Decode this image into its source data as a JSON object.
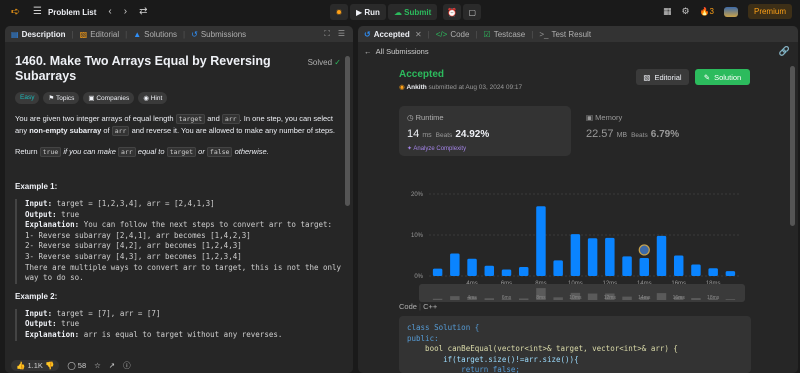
{
  "topbar": {
    "problem_list": "Problem List",
    "run": "Run",
    "submit": "Submit",
    "streak": "3",
    "premium": "Premium"
  },
  "left_tabs": [
    "Description",
    "Editorial",
    "Solutions",
    "Submissions"
  ],
  "problem": {
    "title": "1460. Make Two Arrays Equal by Reversing Subarrays",
    "solved": "Solved",
    "tags": [
      "Easy",
      "Topics",
      "Companies",
      "Hint"
    ],
    "para1_a": "You are given two integer arrays of equal length ",
    "code_target": "target",
    "para1_and": " and ",
    "code_arr": "arr",
    "para1_b": ". In one step, you can select any ",
    "para1_bold": "non-empty subarray",
    "para1_of": " of ",
    "para1_c": " and reverse it. You are allowed to make any number of steps.",
    "para2_a": "Return ",
    "code_true": "true",
    "para2_b": " if you can make ",
    "para2_c": " equal to ",
    "para2_d": " or ",
    "code_false": "false",
    "para2_e": " otherwise.",
    "example1_h": "Example 1:",
    "example1_input_label": "Input:",
    "example1_input": " target = [1,2,3,4], arr = [2,4,1,3]",
    "example1_output_label": "Output:",
    "example1_output": " true",
    "example1_expl_label": "Explanation:",
    "example1_expl": " You can follow the next steps to convert arr to target:\n1- Reverse subarray [2,4,1], arr becomes [1,4,2,3]\n2- Reverse subarray [4,2], arr becomes [1,2,4,3]\n3- Reverse subarray [4,3], arr becomes [1,2,3,4]\nThere are multiple ways to convert arr to target, this is not the only\nway to do so.",
    "example2_h": "Example 2:",
    "example2_input_label": "Input:",
    "example2_input": " target = [7], arr = [7]",
    "example2_output_label": "Output:",
    "example2_output": " true",
    "example2_expl_label": "Explanation:",
    "example2_expl": " arr is equal to target without any reverses."
  },
  "left_footer": {
    "likes": "1.1K",
    "comments": "58"
  },
  "right_tabs": [
    "Accepted",
    "Code",
    "Testcase",
    "Test Result"
  ],
  "submission": {
    "all_submissions": "All Submissions",
    "status": "Accepted",
    "user": "Ankith",
    "submitted_at": " submitted at Aug 03, 2024 09:17",
    "editorial_btn": "Editorial",
    "solution_btn": "Solution",
    "runtime_label": "Runtime",
    "runtime_value": "14",
    "runtime_unit": "ms",
    "runtime_beats_label": "Beats",
    "runtime_beats": "24.92%",
    "analyze": "Analyze Complexity",
    "memory_label": "Memory",
    "memory_value": "22.57",
    "memory_unit": "MB",
    "memory_beats_label": "Beats",
    "memory_beats": "6.79%"
  },
  "chart_data": {
    "type": "bar",
    "ylabel_ticks": [
      "0%",
      "10%",
      "20%"
    ],
    "ylim": [
      0,
      20
    ],
    "x_tick_labels": [
      "4ms",
      "6ms",
      "8ms",
      "10ms",
      "12ms",
      "14ms",
      "16ms",
      "18ms"
    ],
    "values": [
      1.8,
      5.5,
      4.2,
      2.5,
      1.6,
      2.2,
      17,
      3.8,
      10.2,
      9.2,
      9.3,
      4.8,
      4.4,
      9.8,
      5.0,
      2.8,
      1.9,
      1.2
    ],
    "highlight_index": 12,
    "bar_color": "#0a84ff"
  },
  "code": {
    "language_tab": "Code",
    "language": "C++",
    "lines": [
      "class Solution {",
      "public:",
      "    bool canBeEqual(vector<int>& target, vector<int>& arr) {",
      "        if(target.size()!=arr.size()){",
      "            return false;"
    ]
  }
}
